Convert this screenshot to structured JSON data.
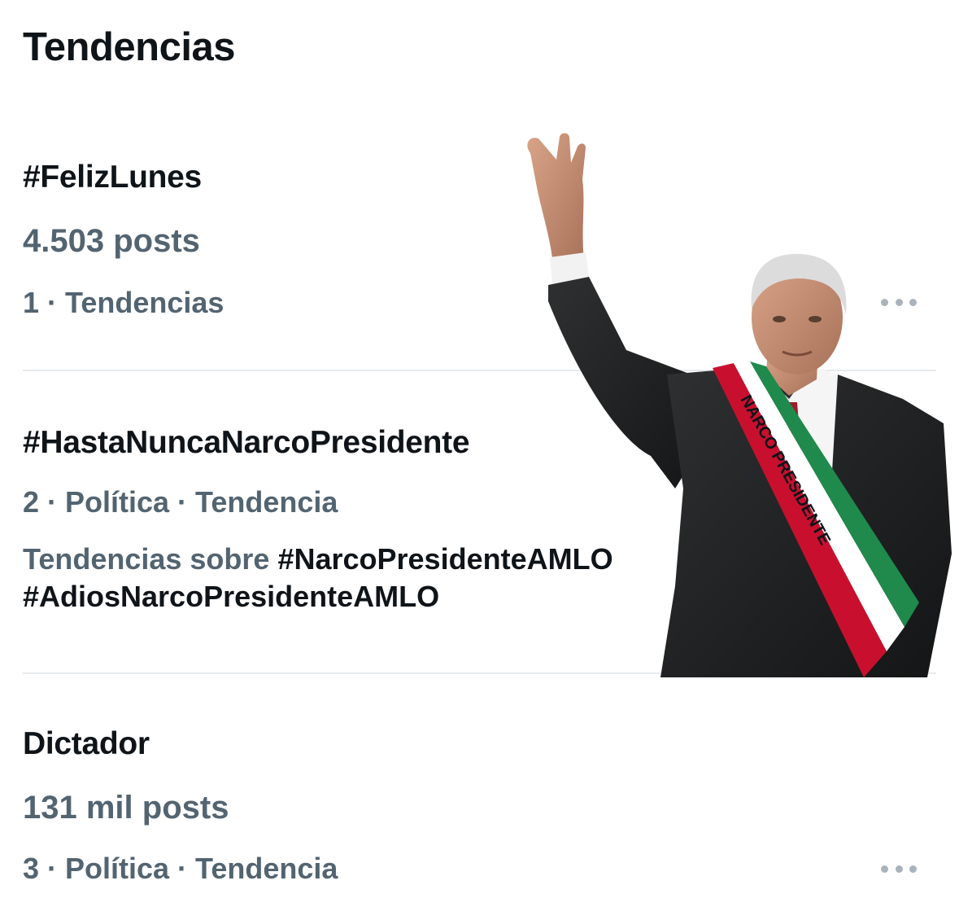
{
  "header": {
    "title": "Tendencias"
  },
  "trends": [
    {
      "name": "#FelizLunes",
      "count": "4.503 posts",
      "meta": "1 · Tendencias"
    },
    {
      "name": "#HastaNuncaNarcoPresidente",
      "meta": "2 · Política · Tendencia",
      "context_prefix": "Tendencias sobre",
      "context_tags": [
        "#NarcoPresidenteAMLO",
        "#AdiosNarcoPresidenteAMLO"
      ]
    },
    {
      "name": "Dictador",
      "count": "131 mil posts",
      "meta": "3 · Política · Tendencia"
    }
  ],
  "overlay": {
    "sash_text": "NARCO PRESIDENTE"
  },
  "icons": {
    "more": "more-horizontal-icon"
  },
  "colors": {
    "primary_text": "#0f1419",
    "secondary_text": "#536471",
    "divider": "#e6eaed"
  }
}
